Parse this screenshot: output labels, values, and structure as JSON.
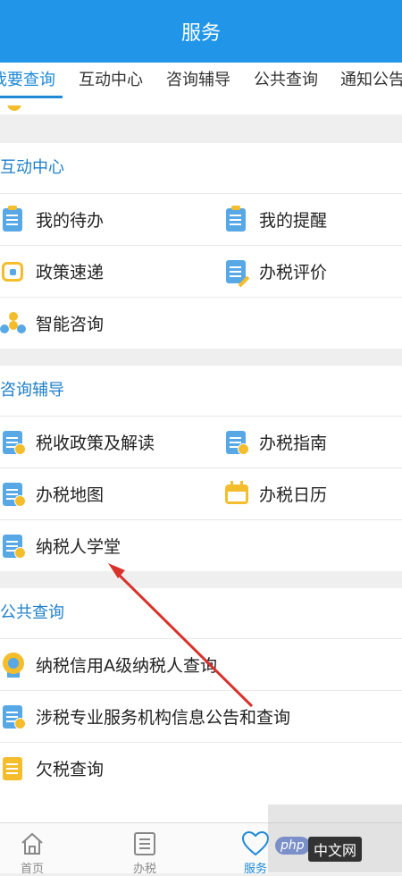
{
  "header": {
    "title": "服务"
  },
  "tabs": [
    {
      "label": "我要查询",
      "active": true
    },
    {
      "label": "互动中心",
      "active": false
    },
    {
      "label": "咨询辅导",
      "active": false
    },
    {
      "label": "公共查询",
      "active": false
    },
    {
      "label": "通知公告",
      "active": false
    }
  ],
  "sections": {
    "interaction": {
      "title": "互动中心",
      "items": [
        "我的待办",
        "我的提醒",
        "政策速递",
        "办税评价",
        "智能咨询"
      ]
    },
    "consult": {
      "title": "咨询辅导",
      "items": [
        "税收政策及解读",
        "办税指南",
        "办税地图",
        "办税日历",
        "纳税人学堂"
      ]
    },
    "public": {
      "title": "公共查询",
      "items": [
        "纳税信用A级纳税人查询",
        "涉税专业服务机构信息公告和查询",
        "欠税查询"
      ]
    }
  },
  "bottom_nav": [
    {
      "label": "首页",
      "icon": "home-icon"
    },
    {
      "label": "办税",
      "icon": "list-icon"
    },
    {
      "label": "服务",
      "icon": "heart-icon",
      "active": true
    }
  ],
  "watermark": {
    "logo": "php",
    "text": "中文网"
  },
  "colors": {
    "accent": "#2196e8",
    "section_title": "#1f7fc9",
    "icon_blue": "#58a8e6",
    "icon_yellow": "#f3bd2c",
    "arrow": "#d9322b"
  }
}
